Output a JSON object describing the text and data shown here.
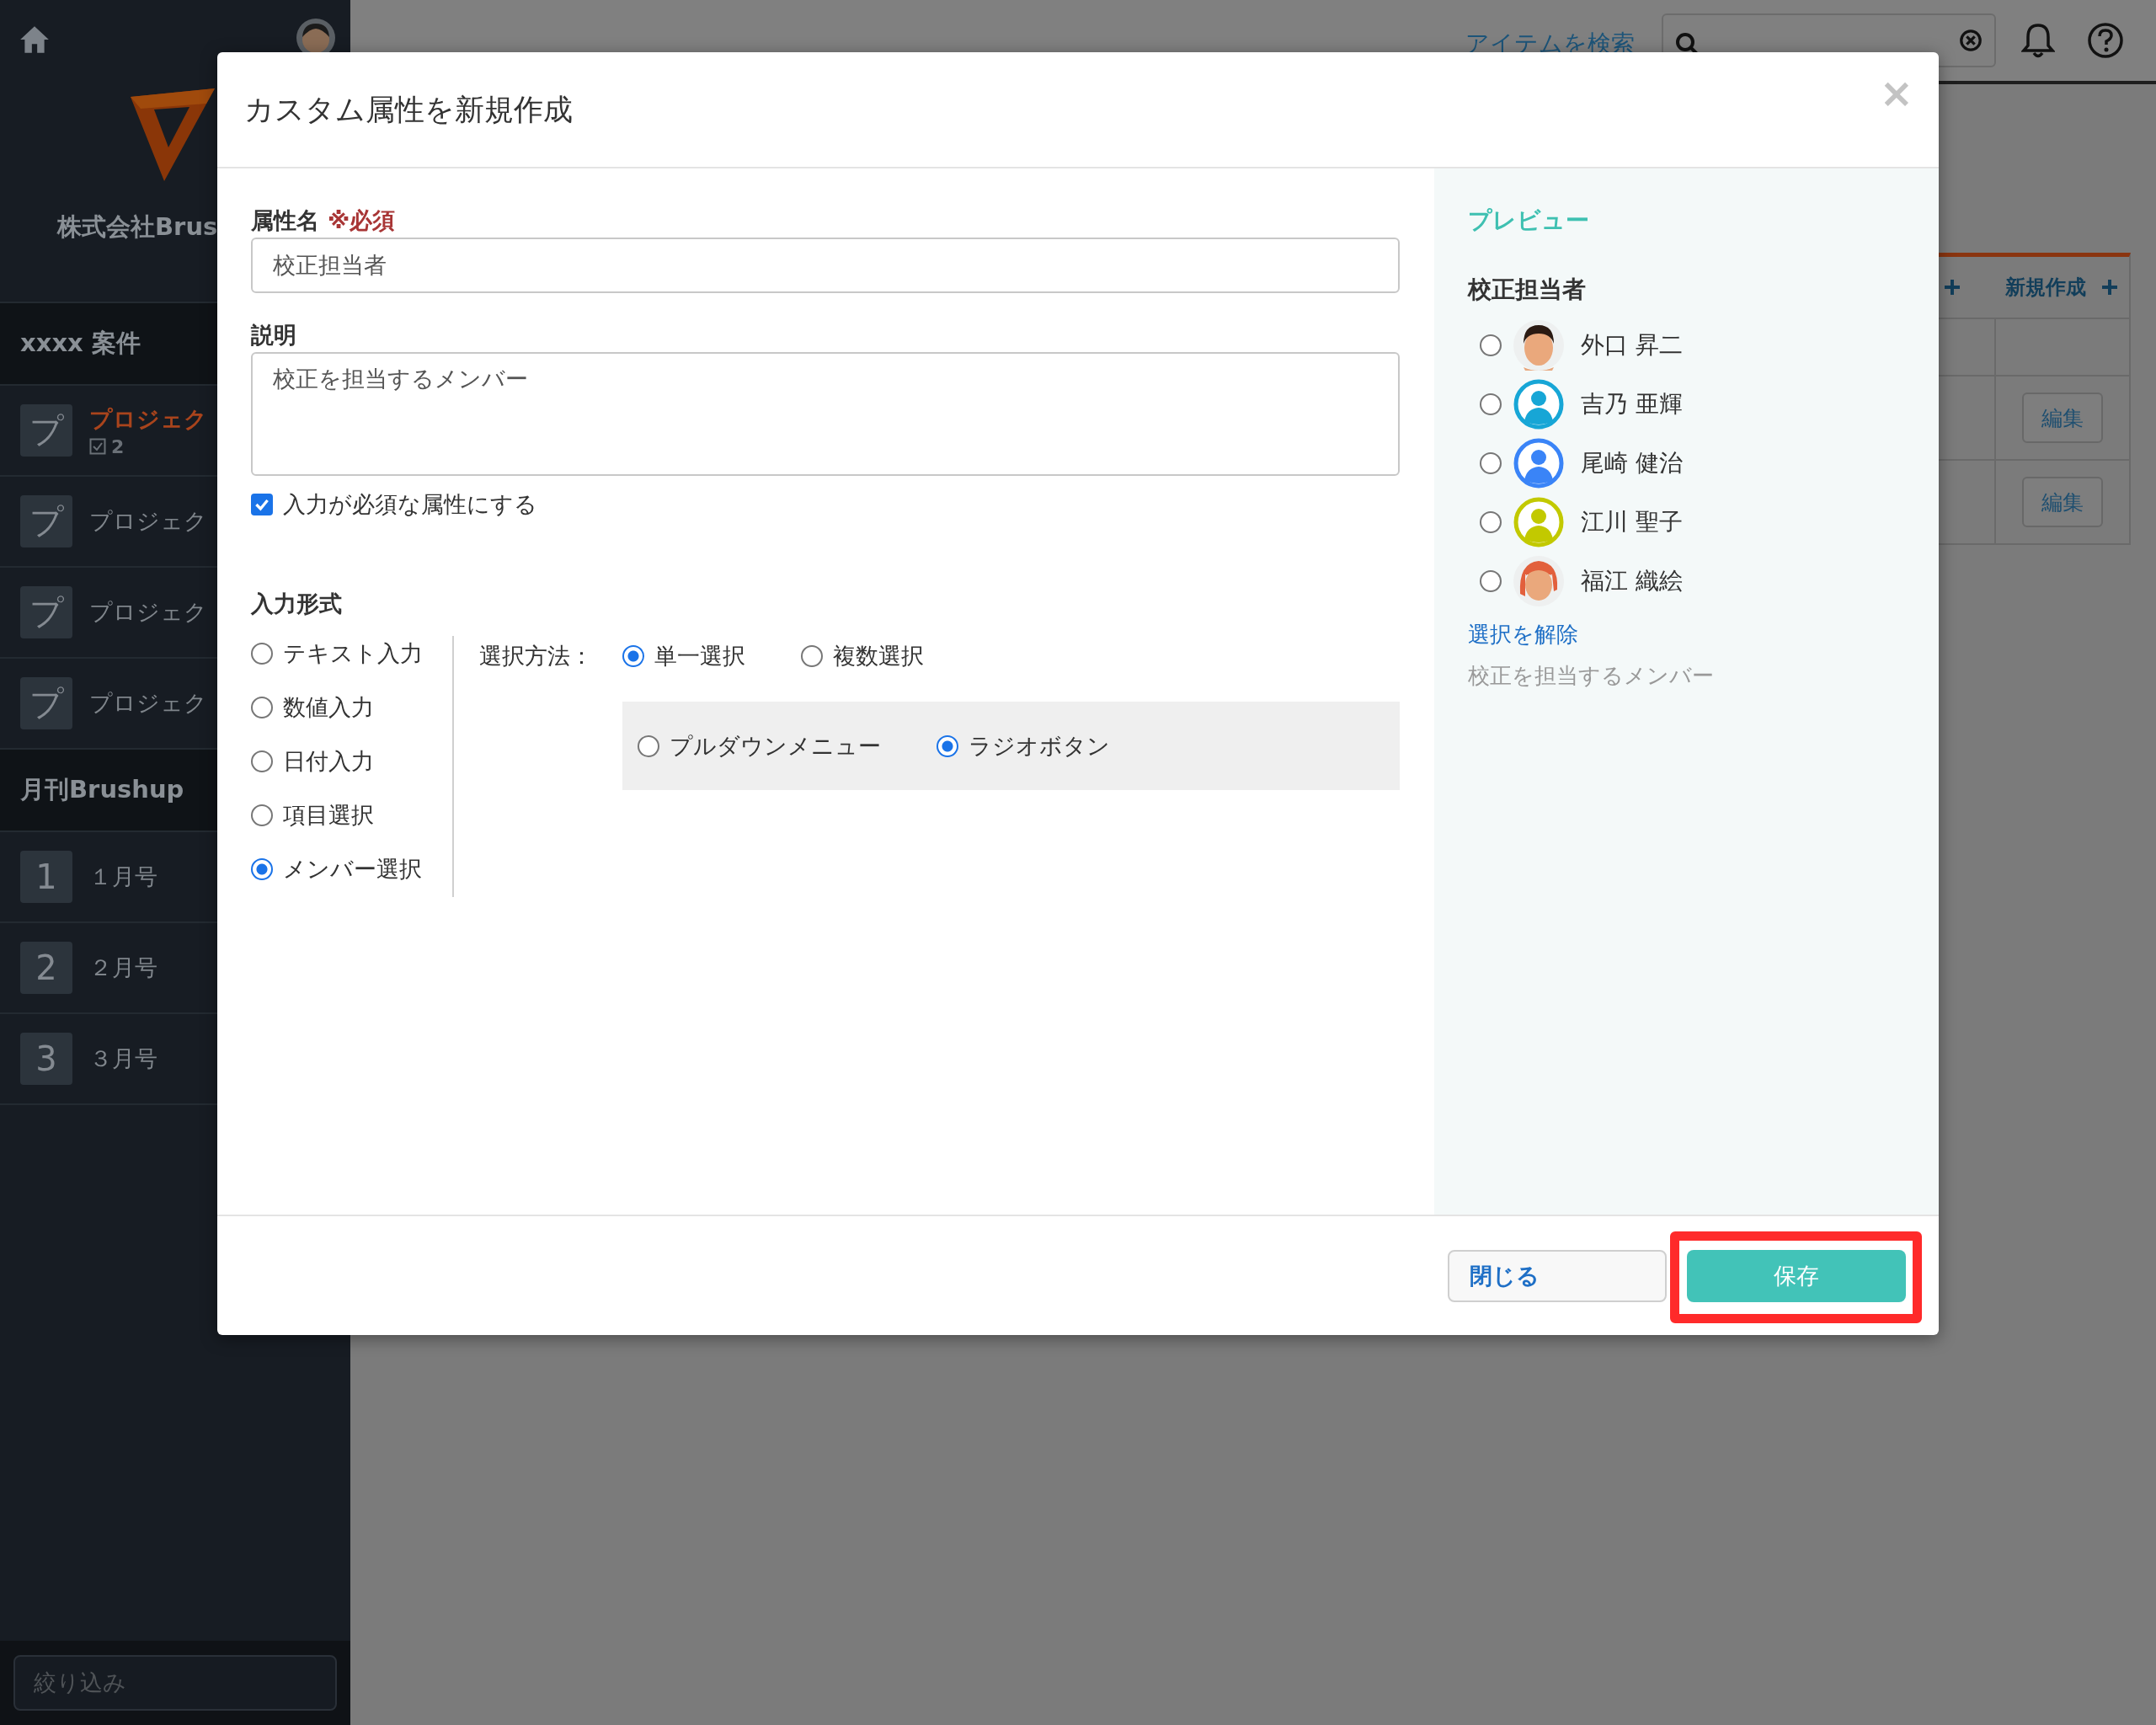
{
  "sidebar": {
    "company": "株式会社Brus",
    "sections": [
      {
        "title": "xxxx 案件",
        "items": [
          {
            "icon": "プ",
            "label": "プロジェク",
            "selected": true,
            "count": "2"
          },
          {
            "icon": "プ",
            "label": "プロジェク",
            "selected": false
          },
          {
            "icon": "プ",
            "label": "プロジェク",
            "selected": false
          },
          {
            "icon": "プ",
            "label": "プロジェク",
            "selected": false
          }
        ]
      },
      {
        "title": "月刊Brushup",
        "items": [
          {
            "icon": "1",
            "label": "１月号",
            "selected": false
          },
          {
            "icon": "2",
            "label": "２月号",
            "selected": false
          },
          {
            "icon": "3",
            "label": "３月号",
            "selected": false
          }
        ]
      }
    ],
    "filter": {
      "placeholder": "絞り込み"
    }
  },
  "topbar": {
    "search_link": "アイテムを検索"
  },
  "background_panel": {
    "header_action": "新規作成",
    "rows": [
      {
        "action": "編集"
      },
      {
        "action": "編集"
      }
    ]
  },
  "modal": {
    "title": "カスタム属性を新規作成",
    "close": "×",
    "name_label": "属性名",
    "required_mark": "※必須",
    "name_value": "校正担当者",
    "description_label": "説明",
    "description_value": "校正を担当するメンバー",
    "required_checkbox": {
      "label": "入力が必須な属性にする",
      "checked": true
    },
    "input_format_label": "入力形式",
    "formats": [
      {
        "label": "テキスト入力",
        "selected": false
      },
      {
        "label": "数値入力",
        "selected": false
      },
      {
        "label": "日付入力",
        "selected": false
      },
      {
        "label": "項目選択",
        "selected": false
      },
      {
        "label": "メンバー選択",
        "selected": true
      }
    ],
    "selection_method_label": "選択方法：",
    "methods": [
      {
        "label": "単一選択",
        "selected": true
      },
      {
        "label": "複数選択",
        "selected": false
      }
    ],
    "display_types": [
      {
        "label": "プルダウンメニュー",
        "selected": false
      },
      {
        "label": "ラジオボタン",
        "selected": true
      }
    ],
    "preview": {
      "heading": "プレビュー",
      "field_label": "校正担当者",
      "members": [
        {
          "name": "外口 昇二",
          "selected": false,
          "kind": "man"
        },
        {
          "name": "吉乃 亜輝",
          "selected": false,
          "kind": "silhouette",
          "color": "#17a6d6"
        },
        {
          "name": "尾崎 健治",
          "selected": false,
          "kind": "silhouette",
          "color": "#3a84f7"
        },
        {
          "name": "江川 聖子",
          "selected": false,
          "kind": "silhouette",
          "color": "#c2c900"
        },
        {
          "name": "福江 織絵",
          "selected": false,
          "kind": "woman"
        }
      ],
      "clear_link": "選択を解除",
      "description": "校正を担当するメンバー"
    },
    "buttons": [
      {
        "label": "閉じる",
        "kind": "secondary",
        "highlighted": false
      },
      {
        "label": "保存",
        "kind": "primary",
        "highlighted": true
      }
    ]
  }
}
